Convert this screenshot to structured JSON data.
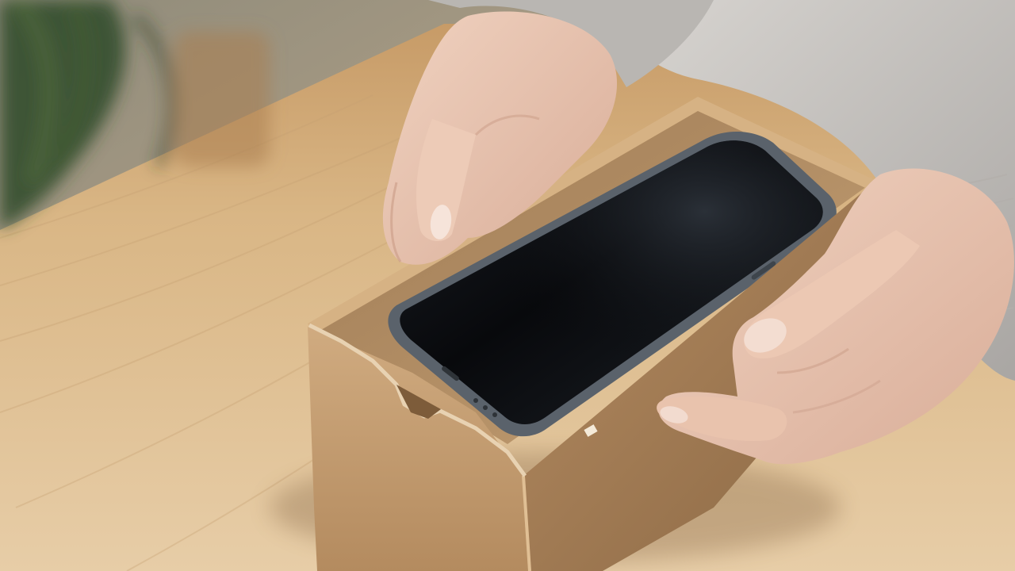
{
  "scene": {
    "objects": {
      "table": "wooden-table",
      "box": "cardboard-box",
      "phone": "smartphone",
      "left_hand": "hand",
      "right_hand": "hand",
      "sweater": "knit-sweater-sleeve",
      "plant": "houseplant"
    }
  },
  "palette": {
    "wall": "#b8a58a",
    "table_light": "#e1c8a3",
    "table_mid": "#d3b184",
    "table_dark": "#c49a68",
    "cardboard": "#b48b5f",
    "cardboard_shadow": "#8e6b45",
    "cardboard_light": "#c9a275",
    "phone_frame": "#59616a",
    "phone_screen": "#0b0d10",
    "skin": "#e8c5b0",
    "skin_shadow": "#c99b86",
    "sweater": "#c9c6c2",
    "plant": "#2f4a2a"
  }
}
